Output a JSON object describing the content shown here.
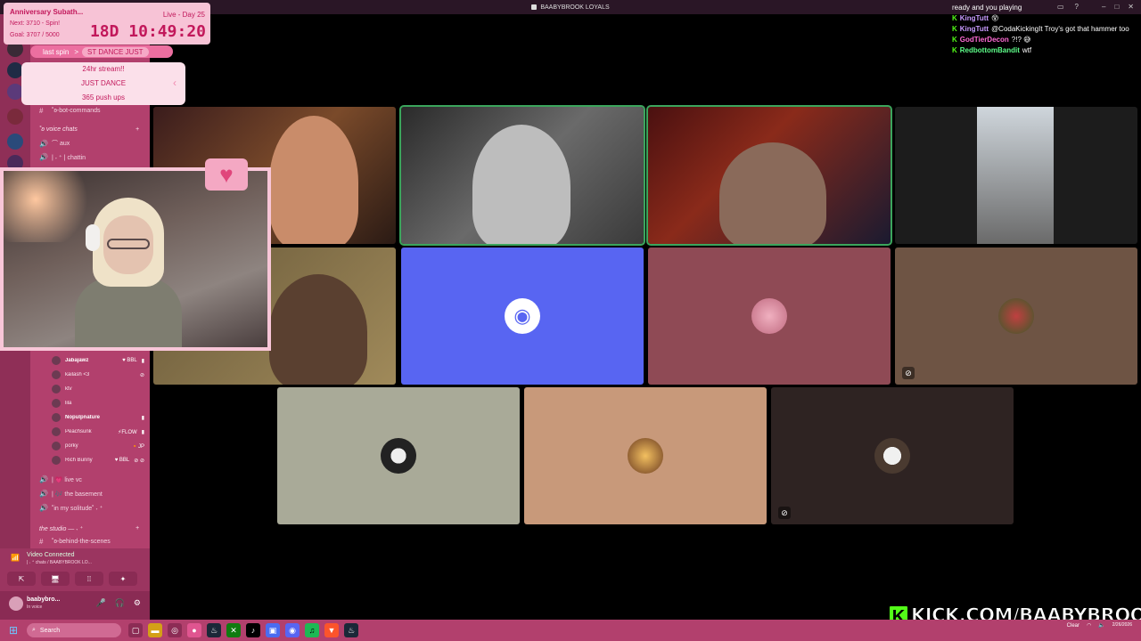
{
  "window": {
    "title": "BAABYBROOK LOYALS",
    "controls": [
      "–",
      "□",
      "✕"
    ]
  },
  "timer": {
    "title": "Anniversary Subath...",
    "next": "Next: 3710 - Spin!",
    "goal": "Goal: 3707 / 5000",
    "live": "Live - Day 25",
    "countdown": "18D 10:49:20"
  },
  "spin": {
    "label": "last spin",
    "arrow": ">",
    "value": "ST DANCE JUST",
    "items": [
      "24hr stream!!",
      "JUST DANCE",
      "365 push ups"
    ]
  },
  "sidebar": {
    "channels": [
      {
        "glyph": "#",
        "label": "˚ʚ-bot-commands"
      },
      {
        "glyph": "🔊",
        "label": "⌒ aux"
      },
      {
        "glyph": "🔊",
        "label": "|  ˖ ⁺ | chattin"
      }
    ],
    "category_voice": "˚ʚ voice chats",
    "members": [
      {
        "name": "Jabajawz",
        "tag": "♥ BBL",
        "bold": true,
        "icon": "▮"
      },
      {
        "name": "kailash <3",
        "tag": "",
        "bold": false,
        "icon": "⊘"
      },
      {
        "name": "ktv",
        "tag": "",
        "bold": false,
        "icon": ""
      },
      {
        "name": "lila",
        "tag": "",
        "bold": false,
        "icon": ""
      },
      {
        "name": "Nopulpnature",
        "tag": "",
        "bold": true,
        "icon": "▮"
      },
      {
        "name": "Peachsunk",
        "tag": "⚡FLOW",
        "bold": false,
        "icon": "▮"
      },
      {
        "name": "porky",
        "tag": "🔸JP",
        "bold": false,
        "icon": ""
      },
      {
        "name": "Rich Bunny",
        "tag": "♥ BBL",
        "bold": false,
        "icon": "⊘ ⊘"
      }
    ],
    "channels2": [
      {
        "glyph": "🔊",
        "label": "| 💗 live vc"
      },
      {
        "glyph": "🔊",
        "label": "| 🎶 the basement"
      },
      {
        "glyph": "🔊",
        "label": "˚in my solitude˚ ˖ ⁺"
      }
    ],
    "category_studio": "the studio — ˖ ⁺",
    "channel_bts": "˚ʚ-behind-the-scenes"
  },
  "voice": {
    "status": "Video Connected",
    "sub": "| ˖ ⁺ chats / BAABYBROOK LO...",
    "buttons": [
      "⇱",
      "🖥",
      "⁞⁞",
      "✦"
    ]
  },
  "user": {
    "name": "baabybro...",
    "status": "In voice",
    "controls": [
      "🎤",
      "🎧",
      "⚙"
    ]
  },
  "chat": [
    {
      "user": "",
      "color": "#ffffff",
      "text": "ready and you playing"
    },
    {
      "user": "KingTutt",
      "color": "#c99bff",
      "text": "😵"
    },
    {
      "user": "KingTutt",
      "color": "#c99bff",
      "text": "@CodaKickingIt Troy's got that hammer too"
    },
    {
      "user": "GodTierDecon",
      "color": "#ff6bd5",
      "text": "?!? 😅"
    },
    {
      "user": "RedbottomBandit",
      "color": "#5eff8a",
      "text": "wtf"
    }
  ],
  "kick": {
    "logo": "K",
    "url": "KICK.COM/BAABYBROOK"
  },
  "taskbar": {
    "search": "Search",
    "weather": "Clear",
    "date": "2/26/2026"
  },
  "colors": {
    "sidebar": "#b2406d",
    "discord_blurple": "#5865f2",
    "speaking": "#3ba55c",
    "kick_green": "#53fc18"
  }
}
